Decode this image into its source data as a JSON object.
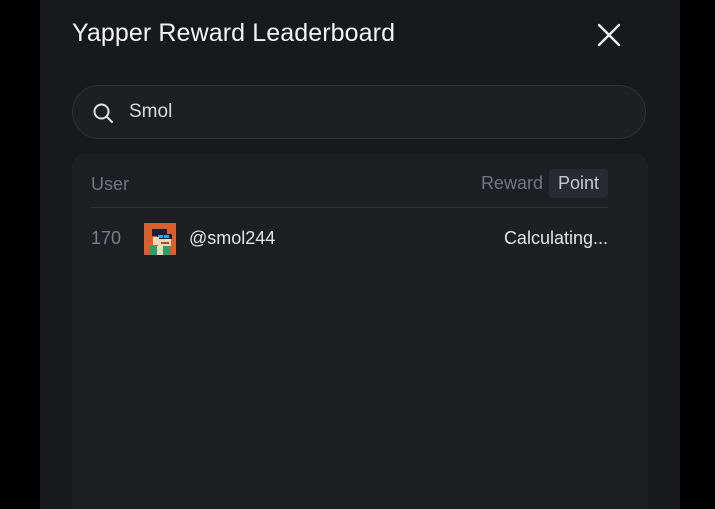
{
  "modal": {
    "title": "Yapper Reward Leaderboard",
    "close_icon": "close-icon"
  },
  "search": {
    "icon": "search-icon",
    "value": "Smol"
  },
  "table": {
    "header_user": "User",
    "toggle_reward": "Reward",
    "toggle_point": "Point",
    "active_toggle": "Point",
    "rows": [
      {
        "rank": "170",
        "handle": "@smol244",
        "value": "Calculating...",
        "avatar": "avatar-image"
      }
    ]
  },
  "colors": {
    "background": "#000000",
    "modal": "#18191c",
    "panel": "#1e1f23",
    "text_primary": "#f2f2f3",
    "text_muted": "#74767d",
    "avatar_bg": "#d9602c"
  }
}
